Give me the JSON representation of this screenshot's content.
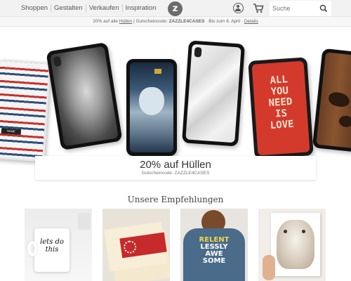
{
  "nav": {
    "items": [
      "Shoppen",
      "Gestalten",
      "Verkaufen",
      "Inspiration"
    ]
  },
  "logo": {
    "letter": "z"
  },
  "search": {
    "placeholder": "Suche"
  },
  "promo": {
    "text_a": "20% auf alle ",
    "link_huellen": "Hüllen",
    "text_b": " | Gutscheincode: ",
    "code": "ZAZZLE4CASES",
    "text_c": " · Bis zum 6. April · ",
    "details": "Details"
  },
  "hero": {
    "title": "20% auf Hüllen",
    "subtitle": "Gutscheincode: ZAZZLE4CASES",
    "case_text": [
      "ALL",
      "YOU",
      "NEED",
      "IS",
      "LOVE"
    ],
    "sweater_label": "NAME"
  },
  "recommendations": {
    "title": "Unsere Empfehlungen",
    "mug_text": "lets do this",
    "shirt_text": [
      "RELENT",
      "LESSLY",
      "AWE",
      "SOME"
    ]
  },
  "colors": {
    "accent": "#1a7ac7",
    "red_case": "#d33a2c",
    "shirt": "#4a6b8a"
  }
}
